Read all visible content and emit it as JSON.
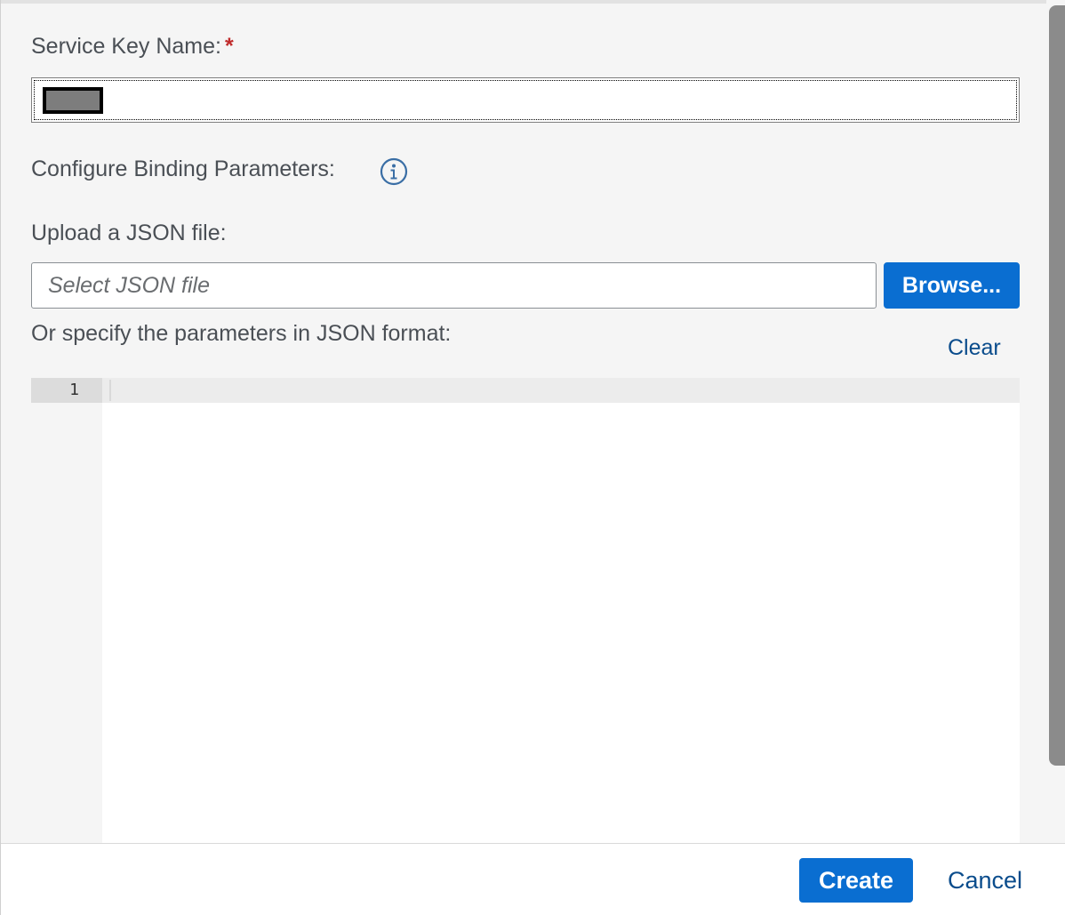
{
  "form": {
    "service_key_label": "Service Key Name:",
    "required_marker": "*",
    "binding_label": "Configure Binding Parameters:",
    "upload_label": "Upload a JSON file:",
    "file_placeholder": "Select JSON file",
    "browse_label": "Browse...",
    "json_label": "Or specify the parameters in JSON format:",
    "clear_label": "Clear"
  },
  "editor": {
    "line_numbers": [
      "1"
    ]
  },
  "footer": {
    "create_label": "Create",
    "cancel_label": "Cancel"
  },
  "colors": {
    "accent": "#0a6ed1",
    "link": "#0a4c8c",
    "required": "#c02b2b"
  }
}
